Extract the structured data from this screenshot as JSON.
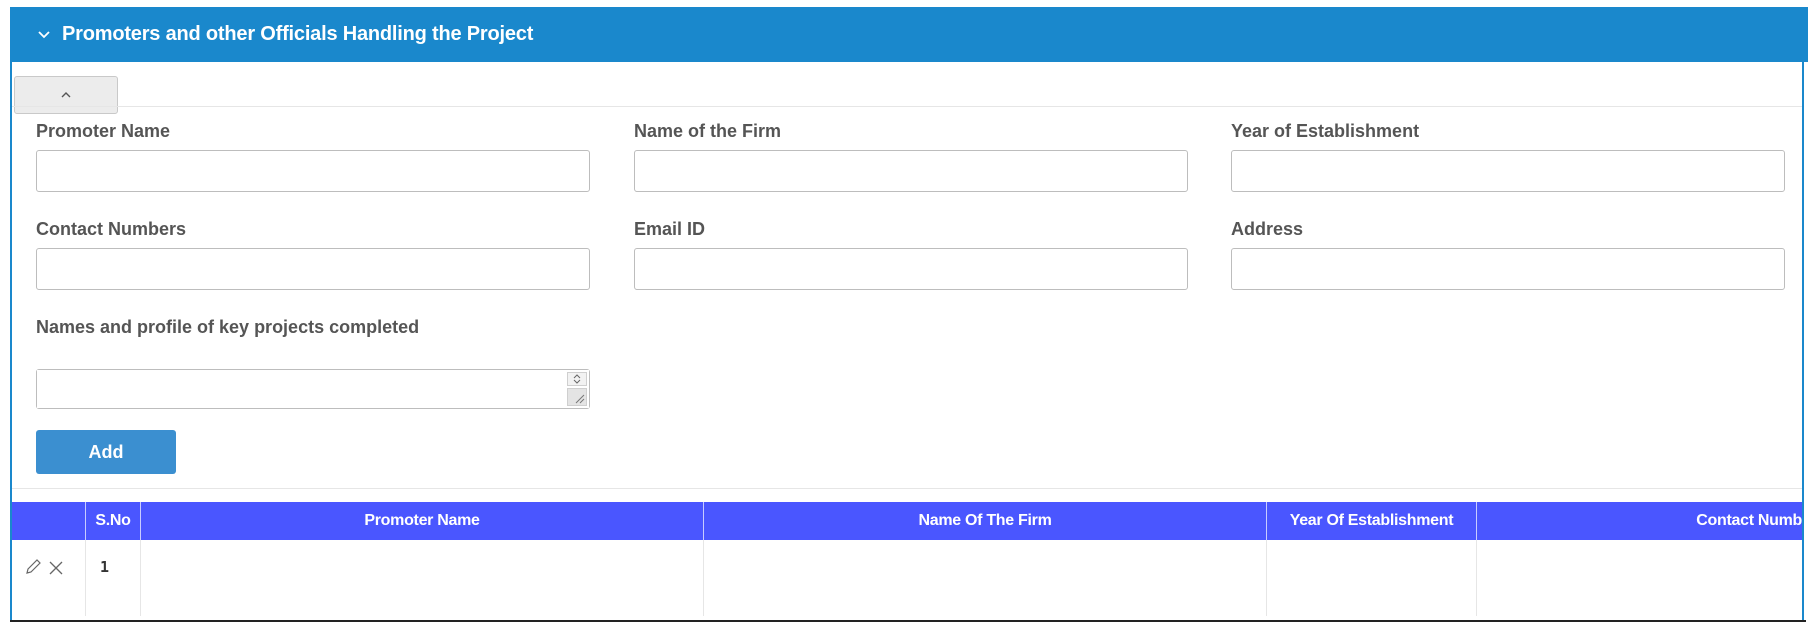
{
  "panel": {
    "title": "Promoters and other Officials Handling the Project",
    "header_color": "#1a88cc",
    "header_icon": "chevron-down-icon",
    "collapse_icon": "chevron-up-icon"
  },
  "form": {
    "promoter_name": {
      "label": "Promoter Name",
      "value": ""
    },
    "firm_name": {
      "label": "Name of the Firm",
      "value": ""
    },
    "year_of_establishment": {
      "label": "Year of Establishment",
      "value": ""
    },
    "contact_numbers": {
      "label": "Contact Numbers",
      "value": ""
    },
    "email_id": {
      "label": "Email ID",
      "value": ""
    },
    "address": {
      "label": "Address",
      "value": ""
    },
    "key_projects": {
      "label": "Names and profile of key projects completed",
      "value": ""
    },
    "add_label": "Add"
  },
  "table": {
    "header_color": "#4a56ff",
    "columns": [
      "",
      "S.No",
      "Promoter Name",
      "Name Of The Firm",
      "Year Of Establishment",
      "Contact Numb"
    ],
    "rows": [
      {
        "sno": "1",
        "promoter_name": "",
        "firm_name": "",
        "year": "",
        "contact": ""
      }
    ],
    "row_action_icons": [
      "pencil-icon",
      "close-icon"
    ]
  }
}
